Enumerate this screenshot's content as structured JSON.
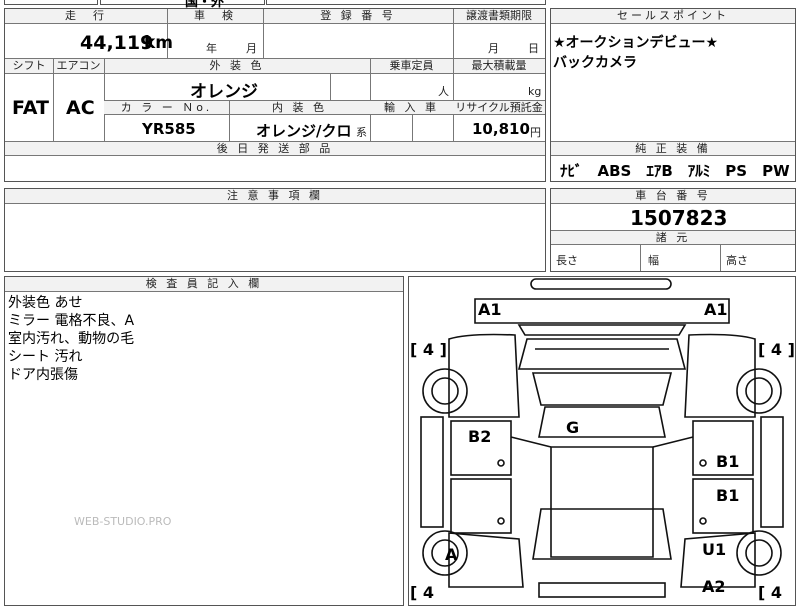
{
  "top_strip": {
    "partial_text": "国・外"
  },
  "spec_table": {
    "headers": {
      "mileage": "走　行",
      "shaken": "車　検",
      "reg_no": "登 録 番 号",
      "transfer_deadline": "譲渡書類期限",
      "shift": "シフト",
      "aircon": "エアコン",
      "exterior_color": "外 装 色",
      "capacity": "乗車定員",
      "max_load": "最大積載量",
      "color_no": "カ ラ ー Ｎo.",
      "interior_color": "内 装 色",
      "import": "輸 入 車",
      "recycle_fee": "リサイクル預託金",
      "later_parts": "後 日 発 送 部 品"
    },
    "values": {
      "mileage": "44,119",
      "mileage_unit": "km",
      "year_unit": "年",
      "month_unit": "月",
      "transfer_month": "月",
      "transfer_day": "日",
      "shift": "FAT",
      "aircon": "AC",
      "exterior_color": "オレンジ",
      "capacity_unit": "人",
      "load_unit": "kg",
      "color_no": "YR585",
      "interior_color": "オレンジ/クロ",
      "interior_suffix": "系",
      "recycle_fee": "10,810",
      "recycle_unit": "円"
    }
  },
  "sales_point": {
    "header": "セールスポイント",
    "lines": [
      "★オークションデビュー★",
      "バックカメラ"
    ]
  },
  "equipment": {
    "header": "純 正 装 備",
    "items": "ﾅﾋﾞ　ABS　ｴｱB　ｱﾙﾐ　PS　PW"
  },
  "caution": {
    "header": "注 意 事 項 欄"
  },
  "chassis": {
    "header": "車 台 番 号",
    "number": "1507823",
    "dims_header": "諸 元",
    "length": "長さ",
    "width": "幅",
    "height": "高さ"
  },
  "inspector": {
    "header": "検 査 員 記 入 欄",
    "notes": [
      "外装色 あせ",
      "ミラー 電格不良、A",
      "室内汚れ、動物の毛",
      "シート 汚れ",
      "ドア内張傷"
    ]
  },
  "watermark": "WEB-STUDIO.PRO",
  "diagram": {
    "marks": {
      "a1_left": "A1",
      "a1_right": "A1",
      "b2": "B2",
      "g": "G",
      "b1_upper": "B1",
      "b1_lower": "B1",
      "a": "A",
      "u1": "U1",
      "a2": "A2"
    },
    "tires": {
      "front_left": "[ 4 ]",
      "front_right": "[ 4 ]",
      "rear_left": "[ 4",
      "rear_right": "[ 4"
    }
  }
}
